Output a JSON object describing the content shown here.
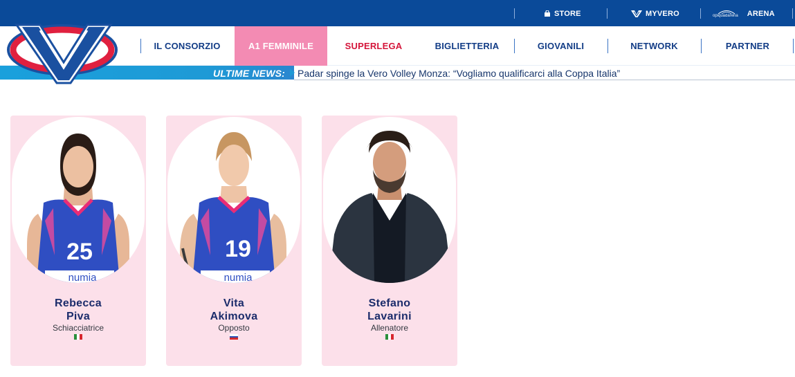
{
  "topbar": {
    "links": [
      {
        "label": "STORE",
        "icon": "shop-icon"
      },
      {
        "label": "MYVERO",
        "icon": "vero-v-icon"
      },
      {
        "small": "opiquadarena",
        "label": "ARENA",
        "icon": "arena-dome-icon"
      }
    ]
  },
  "logo": {
    "name": "vero-volley-logo"
  },
  "nav": {
    "items": [
      {
        "label": "IL CONSORZIO"
      },
      {
        "label": "A1 FEMMINILE"
      },
      {
        "label": "SUPERLEGA"
      },
      {
        "label": "BIGLIETTERIA"
      },
      {
        "label": "GIOVANILI"
      },
      {
        "label": "NETWORK"
      },
      {
        "label": "PARTNER"
      }
    ],
    "active": "A1 FEMMINILE",
    "colors": {
      "primary": "#123c86",
      "active_bg": "#f38bb3",
      "highlight": "#d4153a"
    }
  },
  "ticker": {
    "label": "ULTIME NEWS:",
    "headline": "Padar spinge la Vero Volley Monza: “Vogliamo qualificarci alla Coppa Italia”"
  },
  "roster": [
    {
      "first": "Rebecca",
      "last": "Piva",
      "role": "Schiacciatrice",
      "flag": "italy-flag",
      "number": "25",
      "sponsor": "numia"
    },
    {
      "first": "Vita",
      "last": "Akimova",
      "role": "Opposto",
      "flag": "russia-flag",
      "number": "19",
      "sponsor": "numia"
    },
    {
      "first": "Stefano",
      "last": "Lavarini",
      "role": "Allenatore",
      "flag": "italy-flag"
    }
  ],
  "colors": {
    "card_bg": "#fce0ea",
    "topbar_bg": "#0a4a99",
    "ticker_bg": "#1e9ad6"
  }
}
